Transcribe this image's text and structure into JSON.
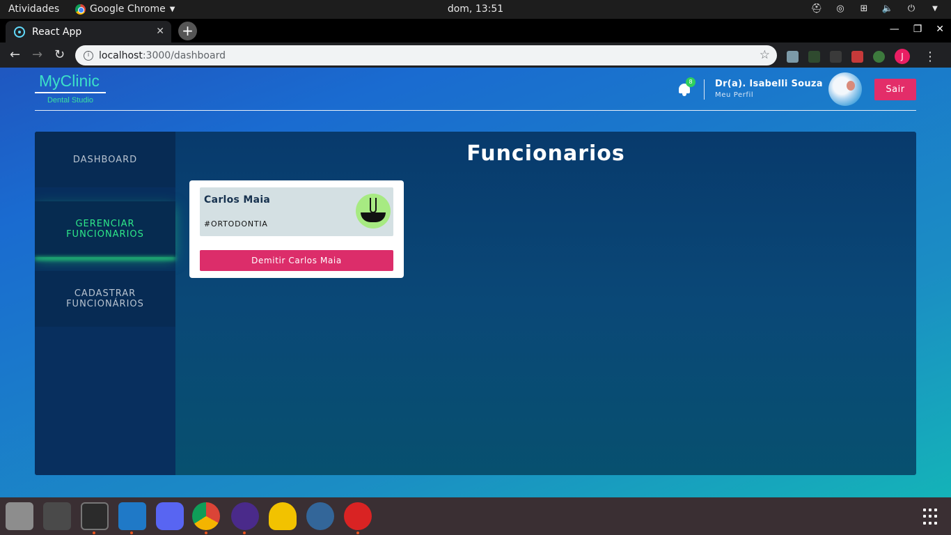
{
  "system": {
    "activities": "Atividades",
    "app_menu": "Google Chrome",
    "clock": "dom, 13:51"
  },
  "browser": {
    "tab_title": "React App",
    "url_host": "localhost",
    "url_path": ":3000/dashboard",
    "profile_initial": "J"
  },
  "header": {
    "logo_title": "MyClinic",
    "logo_subtitle": "Dental Studio",
    "notification_count": "8",
    "user_name": "Dr(a). Isabelli Souza",
    "user_link": "Meu Perfil",
    "logout_label": "Sair"
  },
  "sidebar": {
    "items": [
      {
        "label": "DASHBOARD"
      },
      {
        "label": "GERENCIAR FUNCIONARIOS"
      },
      {
        "label": "CADASTRAR FUNCIONÁRIOS"
      }
    ]
  },
  "main": {
    "title": "Funcionarios",
    "employees": [
      {
        "name": "Carlos Maia",
        "specialty": "#ORTODONTIA",
        "action_label": "Demitir Carlos Maia"
      }
    ]
  },
  "colors": {
    "accent": "#e32d69",
    "active_nav": "#2ee889",
    "panel": "#083a6c",
    "sidebar": "#072b54"
  },
  "dock": {
    "apps": [
      "files-icon",
      "sublime-text-icon",
      "terminal-icon",
      "vscode-icon",
      "discord-icon",
      "chrome-icon",
      "tor-browser-icon",
      "helmet-icon",
      "pgadmin-icon",
      "kali-red-icon"
    ]
  }
}
